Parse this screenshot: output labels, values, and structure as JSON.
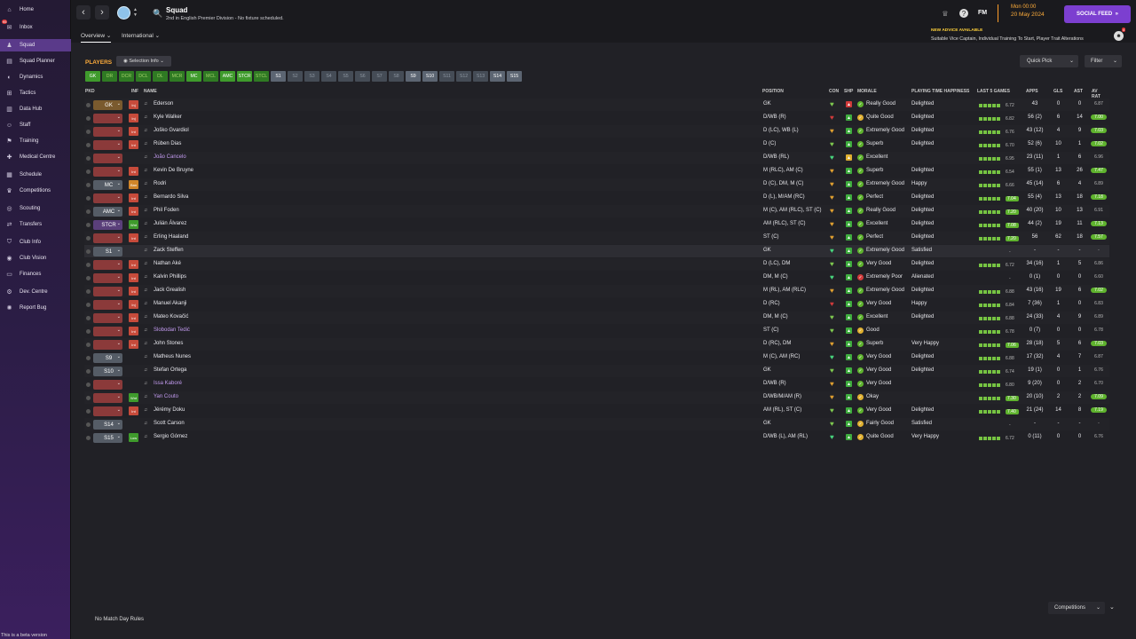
{
  "sidebar": {
    "items": [
      {
        "label": "Home",
        "icon": "home-icon",
        "glyph": "⌂",
        "badge": ""
      },
      {
        "label": "Inbox",
        "icon": "inbox-icon",
        "glyph": "✉",
        "badge": "95"
      },
      {
        "label": "Squad",
        "icon": "squad-icon",
        "glyph": "♟",
        "badge": ""
      },
      {
        "label": "Squad Planner",
        "icon": "squad-planner-icon",
        "glyph": "▤",
        "badge": ""
      },
      {
        "label": "Dynamics",
        "icon": "dynamics-icon",
        "glyph": "◐",
        "badge": ""
      },
      {
        "label": "Tactics",
        "icon": "tactics-icon",
        "glyph": "⊞",
        "badge": ""
      },
      {
        "label": "Data Hub",
        "icon": "data-hub-icon",
        "glyph": "▥",
        "badge": ""
      },
      {
        "label": "Staff",
        "icon": "staff-icon",
        "glyph": "☺",
        "badge": ""
      },
      {
        "label": "Training",
        "icon": "training-icon",
        "glyph": "⚑",
        "badge": ""
      },
      {
        "label": "Medical Centre",
        "icon": "medical-icon",
        "glyph": "✚",
        "badge": ""
      },
      {
        "label": "Schedule",
        "icon": "schedule-icon",
        "glyph": "▦",
        "badge": ""
      },
      {
        "label": "Competitions",
        "icon": "competitions-icon",
        "glyph": "♛",
        "badge": ""
      },
      {
        "label": "Scouting",
        "icon": "scouting-icon",
        "glyph": "◎",
        "badge": ""
      },
      {
        "label": "Transfers",
        "icon": "transfers-icon",
        "glyph": "⇄",
        "badge": ""
      },
      {
        "label": "Club Info",
        "icon": "club-info-icon",
        "glyph": "⛉",
        "badge": ""
      },
      {
        "label": "Club Vision",
        "icon": "club-vision-icon",
        "glyph": "◉",
        "badge": ""
      },
      {
        "label": "Finances",
        "icon": "finances-icon",
        "glyph": "▭",
        "badge": ""
      },
      {
        "label": "Dev. Centre",
        "icon": "dev-centre-icon",
        "glyph": "⚙",
        "badge": ""
      },
      {
        "label": "Report Bug",
        "icon": "report-bug-icon",
        "glyph": "✺",
        "badge": ""
      }
    ],
    "active": "Squad",
    "beta_text": "This is a beta version"
  },
  "header": {
    "title": "Squad",
    "subtitle": "2nd in English Premier Division - No fixture scheduled.",
    "fm_logo": "FM",
    "time": "Mon 00:00",
    "date": "20 May 2024",
    "social_feed": "SOCIAL FEED"
  },
  "tabs": [
    {
      "label": "Overview"
    },
    {
      "label": "International"
    }
  ],
  "advice": {
    "title": "NEW ADVICE AVAILABLE",
    "body": "Suitable Vice Captain, Individual Training To Start, Player Trait Alterations",
    "count": "4"
  },
  "toolbar": {
    "players_label": "PLAYERS",
    "selection_info": "Selection Info",
    "quick_pick": "Quick Pick",
    "filter": "Filter"
  },
  "chips": [
    "GK",
    "DR",
    "DCR",
    "DCL",
    "DL",
    "MCR",
    "MC",
    "MCL",
    "AMC",
    "STCR",
    "STCL",
    "S1",
    "S2",
    "S3",
    "S4",
    "S5",
    "S6",
    "S7",
    "S8",
    "S9",
    "S10",
    "S11",
    "S12",
    "S13",
    "S14",
    "S15"
  ],
  "columns": {
    "pkd": "PKD",
    "inf": "INF",
    "name": "NAME",
    "position": "POSITION",
    "con": "CON",
    "shp": "SHP",
    "morale": "MORALE",
    "pth": "PLAYING TIME HAPPINESS",
    "last5": "LAST 5 GAMES",
    "apps": "APPS",
    "gls": "GLS",
    "ast": "AST",
    "avrat": "AV RAT"
  },
  "rows": [
    {
      "sel": "GK",
      "inf": "Inj",
      "name": "Ederson",
      "pos": "GK",
      "morale": "Really Good",
      "pth": "Delighted",
      "l5": "6.72",
      "apps": "43",
      "gls": "0",
      "ast": "0",
      "avr": "6.87"
    },
    {
      "sel": "",
      "inf": "Inj",
      "name": "Kyle Walker",
      "pos": "D/WB (R)",
      "morale": "Quite Good",
      "pth": "Delighted",
      "l5": "6.82",
      "apps": "56 (2)",
      "gls": "6",
      "ast": "14",
      "avr": "7.00"
    },
    {
      "sel": "",
      "inf": "Int",
      "name": "Joško Gvardiol",
      "pos": "D (LC), WB (L)",
      "morale": "Extremely Good",
      "pth": "Delighted",
      "l5": "6.76",
      "apps": "43 (12)",
      "gls": "4",
      "ast": "9",
      "avr": "7.03"
    },
    {
      "sel": "",
      "inf": "Int",
      "name": "Rúben Dias",
      "pos": "D (C)",
      "morale": "Superb",
      "pth": "Delighted",
      "l5": "6.70",
      "apps": "52 (6)",
      "gls": "10",
      "ast": "1",
      "avr": "7.02"
    },
    {
      "sel": "",
      "inf": "",
      "name": "João Cancelo",
      "pos": "D/WB (RL)",
      "morale": "Excellent",
      "pth": "",
      "l5": "6.95",
      "apps": "23 (11)",
      "gls": "1",
      "ast": "6",
      "avr": "6.96"
    },
    {
      "sel": "",
      "inf": "Int",
      "name": "Kevin De Bruyne",
      "pos": "M (RLC), AM (C)",
      "morale": "Superb",
      "pth": "Delighted",
      "l5": "6.54",
      "apps": "55 (1)",
      "gls": "13",
      "ast": "26",
      "avr": "7.47"
    },
    {
      "sel": "MC",
      "inf": "Ban",
      "name": "Rodri",
      "pos": "D (C), DM, M (C)",
      "morale": "Extremely Good",
      "pth": "Happy",
      "l5": "6.66",
      "apps": "45 (14)",
      "gls": "6",
      "ast": "4",
      "avr": "6.89"
    },
    {
      "sel": "",
      "inf": "Int",
      "name": "Bernardo Silva",
      "pos": "D (L), M/AM (RC)",
      "morale": "Perfect",
      "pth": "Delighted",
      "l5": "7.04",
      "apps": "55 (4)",
      "gls": "13",
      "ast": "18",
      "avr": "7.18"
    },
    {
      "sel": "AMC",
      "inf": "Int",
      "name": "Phil Foden",
      "pos": "M (C), AM (RLC), ST (C)",
      "morale": "Really Good",
      "pth": "Delighted",
      "l5": "7.20",
      "apps": "40 (20)",
      "gls": "10",
      "ast": "13",
      "avr": "6.91"
    },
    {
      "sel": "STCR",
      "inf": "Wnt",
      "name": "Julián Álvarez",
      "pos": "AM (RLC), ST (C)",
      "morale": "Excellent",
      "pth": "Delighted",
      "l5": "7.08",
      "apps": "44 (2)",
      "gls": "19",
      "ast": "11",
      "avr": "7.13"
    },
    {
      "sel": "",
      "inf": "Int",
      "name": "Erling Haaland",
      "pos": "ST (C)",
      "morale": "Perfect",
      "pth": "Delighted",
      "l5": "7.20",
      "apps": "56",
      "gls": "62",
      "ast": "18",
      "avr": "7.57"
    },
    {
      "sel": "S1",
      "inf": "",
      "name": "Zack Steffen",
      "pos": "GK",
      "morale": "Extremely Good",
      "pth": "Satisfied",
      "l5": "-",
      "apps": "-",
      "gls": "-",
      "ast": "-",
      "avr": "-"
    },
    {
      "sel": "",
      "inf": "Int",
      "name": "Nathan Aké",
      "pos": "D (LC), DM",
      "morale": "Very Good",
      "pth": "Delighted",
      "l5": "6.72",
      "apps": "34 (16)",
      "gls": "1",
      "ast": "5",
      "avr": "6.86"
    },
    {
      "sel": "",
      "inf": "Int",
      "name": "Kalvin Phillips",
      "pos": "DM, M (C)",
      "morale": "Extremely Poor",
      "pth": "Alienated",
      "l5": "-",
      "apps": "0 (1)",
      "gls": "0",
      "ast": "0",
      "avr": "6.60"
    },
    {
      "sel": "",
      "inf": "Int",
      "name": "Jack Grealish",
      "pos": "M (RL), AM (RLC)",
      "morale": "Extremely Good",
      "pth": "Delighted",
      "l5": "6.88",
      "apps": "43 (16)",
      "gls": "19",
      "ast": "6",
      "avr": "7.02"
    },
    {
      "sel": "",
      "inf": "Inj",
      "name": "Manuel Akanji",
      "pos": "D (RC)",
      "morale": "Very Good",
      "pth": "Happy",
      "l5": "6.84",
      "apps": "7 (36)",
      "gls": "1",
      "ast": "0",
      "avr": "6.83"
    },
    {
      "sel": "",
      "inf": "Int",
      "name": "Mateo Kovačić",
      "pos": "DM, M (C)",
      "morale": "Excellent",
      "pth": "Delighted",
      "l5": "6.88",
      "apps": "24 (33)",
      "gls": "4",
      "ast": "9",
      "avr": "6.89"
    },
    {
      "sel": "",
      "inf": "Int",
      "name": "Slobodan Tedić",
      "pos": "ST (C)",
      "morale": "Good",
      "pth": "",
      "l5": "6.78",
      "apps": "0 (7)",
      "gls": "0",
      "ast": "0",
      "avr": "6.78"
    },
    {
      "sel": "",
      "inf": "Int",
      "name": "John Stones",
      "pos": "D (RC), DM",
      "morale": "Superb",
      "pth": "Very Happy",
      "l5": "7.06",
      "apps": "28 (18)",
      "gls": "5",
      "ast": "6",
      "avr": "7.03"
    },
    {
      "sel": "S9",
      "inf": "",
      "name": "Matheus Nunes",
      "pos": "M (C), AM (RC)",
      "morale": "Very Good",
      "pth": "Delighted",
      "l5": "6.88",
      "apps": "17 (32)",
      "gls": "4",
      "ast": "7",
      "avr": "6.87"
    },
    {
      "sel": "S10",
      "inf": "",
      "name": "Stefan Ortega",
      "pos": "GK",
      "morale": "Very Good",
      "pth": "Delighted",
      "l5": "6.74",
      "apps": "19 (1)",
      "gls": "0",
      "ast": "1",
      "avr": "6.76"
    },
    {
      "sel": "",
      "inf": "",
      "name": "Issa Kaboré",
      "pos": "D/WB (R)",
      "morale": "Very Good",
      "pth": "",
      "l5": "6.80",
      "apps": "9 (20)",
      "gls": "0",
      "ast": "2",
      "avr": "6.70"
    },
    {
      "sel": "",
      "inf": "Wnt",
      "name": "Yan Couto",
      "pos": "D/WB/M/AM (R)",
      "morale": "Okay",
      "pth": "",
      "l5": "7.30",
      "apps": "20 (10)",
      "gls": "2",
      "ast": "2",
      "avr": "7.09"
    },
    {
      "sel": "",
      "inf": "Int",
      "name": "Jérémy Doku",
      "pos": "AM (RL), ST (C)",
      "morale": "Very Good",
      "pth": "Delighted",
      "l5": "7.40",
      "apps": "21 (24)",
      "gls": "14",
      "ast": "8",
      "avr": "7.19"
    },
    {
      "sel": "S14",
      "inf": "",
      "name": "Scott Carson",
      "pos": "GK",
      "morale": "Fairly Good",
      "pth": "Satisfied",
      "l5": "-",
      "apps": "-",
      "gls": "-",
      "ast": "-",
      "avr": "-"
    },
    {
      "sel": "S15",
      "inf": "Low",
      "name": "Sergio Gómez",
      "pos": "D/WB (L), AM (RL)",
      "morale": "Quite Good",
      "pth": "Very Happy",
      "l5": "6.72",
      "apps": "0 (11)",
      "gls": "0",
      "ast": "0",
      "avr": "6.76"
    }
  ],
  "footer": {
    "rules": "No Match Day Rules",
    "competitions": "Competitions"
  },
  "colors": {
    "accent_orange": "#ffad3b",
    "social_purple": "#7c3fd0",
    "good_green": "#5fb32e"
  }
}
